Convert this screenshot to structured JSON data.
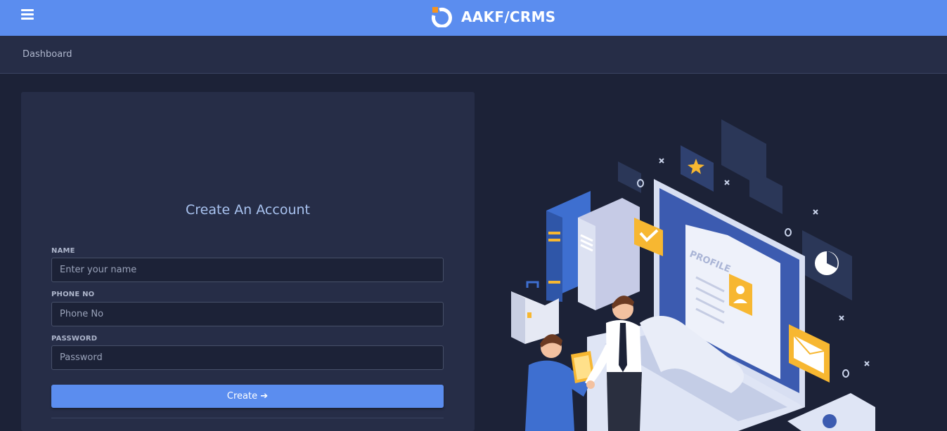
{
  "header": {
    "app_title": "AAKF/CRMS",
    "brand_color": "#5b8def",
    "menu_icon": "hamburger-menu-icon"
  },
  "breadcrumb": {
    "current": "Dashboard"
  },
  "form": {
    "title": "Create An Account",
    "name_label": "NAME",
    "name_placeholder": "Enter your name",
    "phone_label": "PHONE NO",
    "phone_placeholder": "Phone No",
    "password_label": "PASSWORD",
    "password_placeholder": "Password",
    "submit_label": "Create ➔"
  },
  "illustration": {
    "profile_text": "PROFILE",
    "icons": [
      "star-icon",
      "check-icon",
      "pie-chart-icon",
      "mail-icon",
      "user-icon",
      "briefcase-icon"
    ]
  },
  "colors": {
    "background": "#1c2237",
    "panel": "#262d47",
    "accent": "#5b8def",
    "highlight": "#f7b731"
  }
}
